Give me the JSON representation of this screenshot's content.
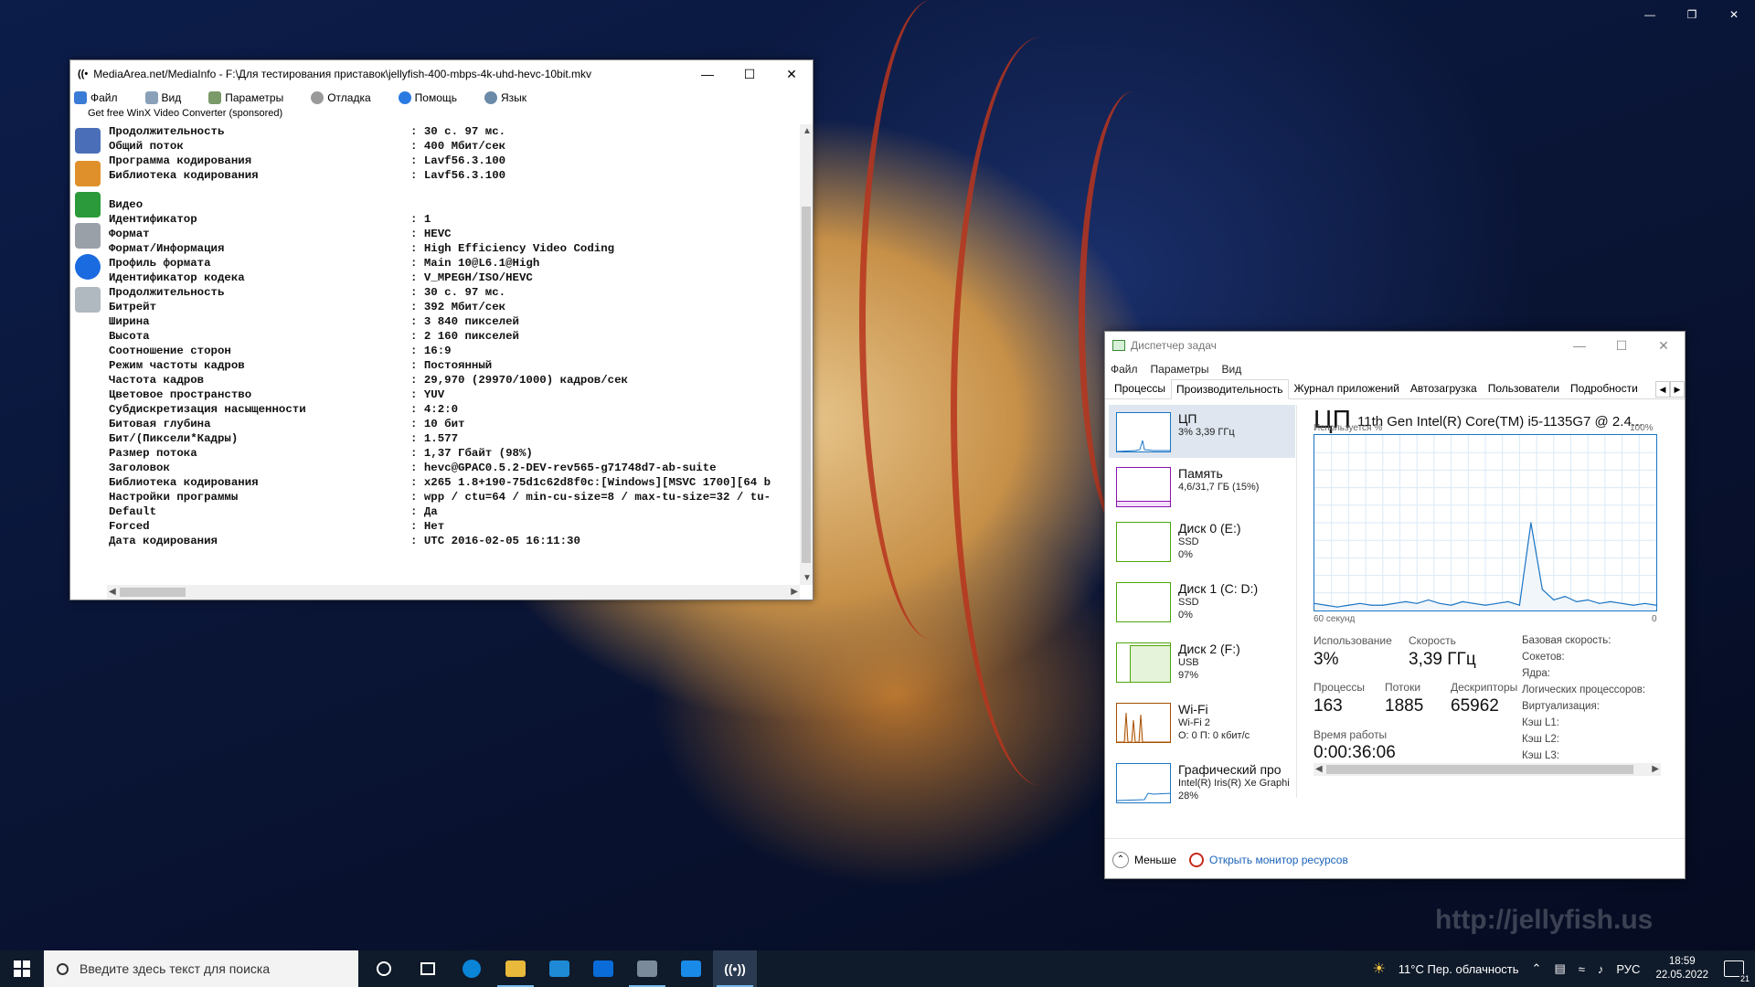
{
  "desktop": {
    "watermark": "http://jellyfish.us"
  },
  "mediainfo": {
    "title": "MediaArea.net/MediaInfo - F:\\Для тестирования приставок\\jellyfish-400-mbps-4k-uhd-hevc-10bit.mkv",
    "menu": [
      "Файл",
      "Вид",
      "Параметры",
      "Отладка",
      "Помощь",
      "Язык"
    ],
    "sponsored": "Get free WinX Video Converter (sponsored)",
    "rows": [
      {
        "k": "Продолжительность",
        "v": ": 30 с. 97 мс."
      },
      {
        "k": "Общий поток",
        "v": ": 400 Мбит/сек"
      },
      {
        "k": "Программа кодирования",
        "v": ": Lavf56.3.100"
      },
      {
        "k": "Библиотека кодирования",
        "v": ": Lavf56.3.100"
      },
      {
        "k": "",
        "v": ""
      },
      {
        "k": "Видео",
        "v": ""
      },
      {
        "k": "Идентификатор",
        "v": ": 1"
      },
      {
        "k": "Формат",
        "v": ": HEVC"
      },
      {
        "k": "Формат/Информация",
        "v": ": High Efficiency Video Coding"
      },
      {
        "k": "Профиль формата",
        "v": ": Main 10@L6.1@High"
      },
      {
        "k": "Идентификатор кодека",
        "v": ": V_MPEGH/ISO/HEVC"
      },
      {
        "k": "Продолжительность",
        "v": ": 30 с. 97 мс."
      },
      {
        "k": "Битрейт",
        "v": ": 392 Мбит/сек"
      },
      {
        "k": "Ширина",
        "v": ": 3 840 пикселей"
      },
      {
        "k": "Высота",
        "v": ": 2 160 пикселей"
      },
      {
        "k": "Соотношение сторон",
        "v": ": 16:9"
      },
      {
        "k": "Режим частоты кадров",
        "v": ": Постоянный"
      },
      {
        "k": "Частота кадров",
        "v": ": 29,970 (29970/1000) кадров/сек"
      },
      {
        "k": "Цветовое пространство",
        "v": ": YUV"
      },
      {
        "k": "Субдискретизация насыщенности",
        "v": ": 4:2:0"
      },
      {
        "k": "Битовая глубина",
        "v": ": 10 бит"
      },
      {
        "k": "Бит/(Пиксели*Кадры)",
        "v": ": 1.577"
      },
      {
        "k": "Размер потока",
        "v": ": 1,37 Гбайт (98%)"
      },
      {
        "k": "Заголовок",
        "v": ": hevc@GPAC0.5.2-DEV-rev565-g71748d7-ab-suite"
      },
      {
        "k": "Библиотека кодирования",
        "v": ": x265 1.8+190-75d1c62d8f0c:[Windows][MSVC 1700][64 b"
      },
      {
        "k": "Настройки программы",
        "v": ": wpp / ctu=64 / min-cu-size=8 / max-tu-size=32 / tu-"
      },
      {
        "k": "Default",
        "v": ": Да"
      },
      {
        "k": "Forced",
        "v": ": Нет"
      },
      {
        "k": "Дата кодирования",
        "v": ": UTC 2016-02-05 16:11:30"
      }
    ]
  },
  "taskmgr": {
    "title": "Диспетчер задач",
    "menu": [
      "Файл",
      "Параметры",
      "Вид"
    ],
    "tabs": [
      "Процессы",
      "Производительность",
      "Журнал приложений",
      "Автозагрузка",
      "Пользователи",
      "Подробности"
    ],
    "resources": [
      {
        "name": "ЦП",
        "sub1": "3% 3,39 ГГц",
        "sub2": "",
        "color": "#1b75c4"
      },
      {
        "name": "Память",
        "sub1": "4,6/31,7 ГБ (15%)",
        "sub2": "",
        "color": "#8b12ae"
      },
      {
        "name": "Диск 0 (E:)",
        "sub1": "SSD",
        "sub2": "0%",
        "color": "#4da60c"
      },
      {
        "name": "Диск 1 (C: D:)",
        "sub1": "SSD",
        "sub2": "0%",
        "color": "#4da60c"
      },
      {
        "name": "Диск 2 (F:)",
        "sub1": "USB",
        "sub2": "97%",
        "color": "#4da60c"
      },
      {
        "name": "Wi-Fi",
        "sub1": "Wi-Fi 2",
        "sub2": "О: 0 П: 0 кбит/с",
        "color": "#a74f01"
      },
      {
        "name": "Графический про",
        "sub1": "Intel(R) Iris(R) Xe Graphi",
        "sub2": "28%",
        "color": "#1b75c4"
      }
    ],
    "cpu": {
      "heading": "ЦП",
      "model": "11th Gen Intel(R) Core(TM) i5-1135G7 @ 2.4...",
      "util_label": "Используется %",
      "max_label": "100%",
      "time_label": "60 секунд",
      "zero_label": "0",
      "usage_label": "Использование",
      "usage": "3%",
      "speed_label": "Скорость",
      "speed": "3,39 ГГц",
      "proc_label": "Процессы",
      "proc": "163",
      "threads_label": "Потоки",
      "threads": "1885",
      "handles_label": "Дескрипторы",
      "handles": "65962",
      "uptime_label": "Время работы",
      "uptime": "0:00:36:06",
      "specs": [
        "Базовая скорость:",
        "Сокетов:",
        "Ядра:",
        "Логических процессоров:",
        "Виртуализация:",
        "Кэш L1:",
        "Кэш L2:",
        "Кэш L3:"
      ]
    },
    "footer": {
      "less": "Меньше",
      "monitor": "Открыть монитор ресурсов"
    }
  },
  "chart_data": {
    "type": "line",
    "title": "",
    "xlabel": "60 секунд",
    "ylabel": "Используется %",
    "ylim": [
      0,
      100
    ],
    "x": [
      0,
      2,
      4,
      6,
      8,
      10,
      12,
      14,
      16,
      18,
      20,
      22,
      24,
      26,
      28,
      30,
      32,
      34,
      36,
      38,
      40,
      42,
      44,
      46,
      48,
      50,
      52,
      54,
      56,
      58,
      60
    ],
    "series": [
      {
        "values": [
          4,
          3,
          2,
          3,
          4,
          3,
          3,
          4,
          5,
          4,
          6,
          4,
          3,
          5,
          4,
          3,
          4,
          5,
          3,
          50,
          12,
          6,
          8,
          5,
          6,
          4,
          5,
          4,
          3,
          4,
          3
        ]
      }
    ],
    "grid": true
  },
  "taskbar": {
    "search_placeholder": "Введите здесь текст для поиска",
    "weather": "11°C  Пер. облачность",
    "lang": "РУС",
    "time": "18:59",
    "date": "22.05.2022",
    "notif": "21",
    "apps": [
      "#0a84d6",
      "#e8b93a",
      "#1e8ad6",
      "#0a6cd8",
      "#7a8a9a",
      "#1a8ae8",
      "#2a3a50"
    ]
  }
}
